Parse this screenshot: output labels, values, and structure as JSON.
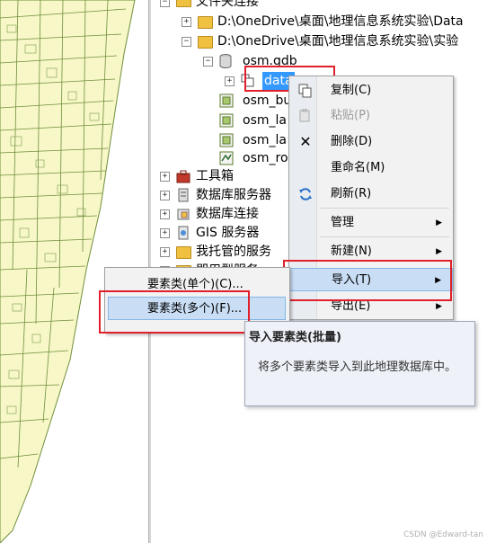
{
  "tree": {
    "folder_connections": "文件夹连接",
    "path1": "D:\\OneDrive\\桌面\\地理信息系统实验\\Data",
    "path2": "D:\\OneDrive\\桌面\\地理信息系统实验\\实验",
    "gdb": "osm.gdb",
    "dataset": "data",
    "fc1": "osm_bu",
    "fc2": "osm_la",
    "fc3": "osm_la",
    "fc4": "osm_ro",
    "toolbox": "工具箱",
    "db_servers": "数据库服务器",
    "db_connections": "数据库连接",
    "gis_servers": "GIS 服务器",
    "hosted_services": "我托管的服务",
    "ready_services": "即用型服务"
  },
  "context_menu": {
    "copy": "复制(C)",
    "paste": "粘贴(P)",
    "delete": "删除(D)",
    "rename": "重命名(M)",
    "refresh": "刷新(R)",
    "manage": "管理",
    "new": "新建(N)",
    "import": "导入(T)",
    "export": "导出(E)"
  },
  "submenu": {
    "single": "要素类(单个)(C)...",
    "multiple": "要素类(多个)(F)..."
  },
  "tooltip": {
    "title": "导入要素类(批量)",
    "body": "将多个要素类导入到此地理数据库中。"
  },
  "watermark": "CSDN @Edward-tan",
  "colors": {
    "menu_highlight": "#c9def5",
    "red_box": "#e0202a",
    "map_fill": "#f7f7c8"
  }
}
